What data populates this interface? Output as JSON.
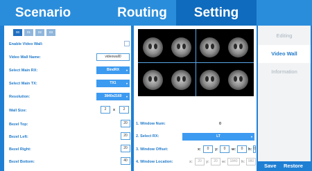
{
  "nav": {
    "tabs": [
      "Scenario",
      "Routing",
      "Setting"
    ]
  },
  "groups": [
    "00",
    "01",
    "02",
    "03"
  ],
  "form": {
    "enable_label": "Enable Video Wall:",
    "name_label": "Video Wall Name:",
    "name_value": "videowall0",
    "main_rx_label": "Select Main RX:",
    "main_rx_value": "BindRX",
    "main_tx_label": "Select Main TX:",
    "main_tx_value": "TX1",
    "resolution_label": "Resolution:",
    "resolution_value": "3840x2160",
    "wall_size_label": "Wall Size:",
    "wall_size_cols": "2",
    "wall_size_x": "x",
    "wall_size_rows": "2",
    "bezel_top_label": "Bezel Top:",
    "bezel_top_value": "20",
    "bezel_left_label": "Bezel Left:",
    "bezel_left_value": "20",
    "bezel_right_label": "Bezel Right:",
    "bezel_right_value": "20",
    "bezel_bottom_label": "Bezel Bottom:",
    "bezel_bottom_value": "40"
  },
  "window": {
    "num_label": "1. Window Num:",
    "num_value": "0",
    "rx_label": "2. Select RX:",
    "rx_value": "LT",
    "offset_label": "3. Window Offset:",
    "offset": {
      "x_label": "x:",
      "x": "0",
      "y_label": "y:",
      "y": "0",
      "w_label": "w:",
      "w": "0",
      "h_label": "h:",
      "h": "0"
    },
    "location_label": "4. Window Location:",
    "location": {
      "x_label": "x:",
      "x": "20",
      "y_label": "y:",
      "y": "20",
      "w_label": "w:",
      "w": "1840",
      "h_label": "h:",
      "h": "980"
    }
  },
  "sidebar": {
    "items": [
      "Editing",
      "Video Wall",
      "Information"
    ]
  },
  "footer": {
    "save": "Save",
    "restore": "Restore"
  },
  "colors": {
    "accent": "#2a8ddb",
    "active_tab": "#0f6bbd",
    "select": "#3c9af0"
  }
}
